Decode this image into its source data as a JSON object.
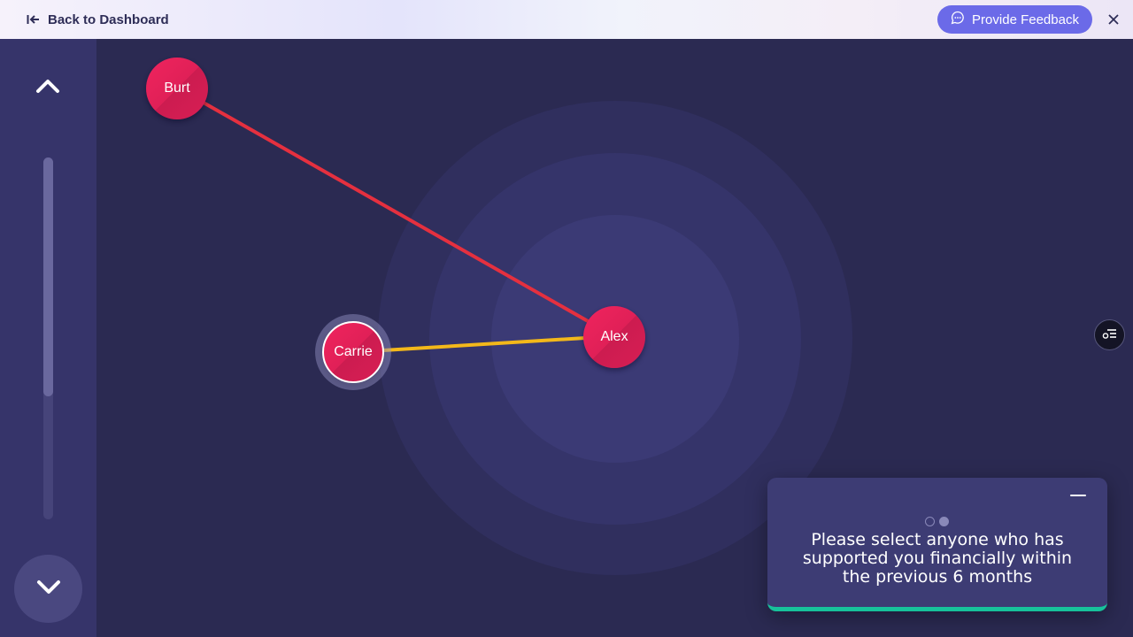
{
  "header": {
    "back_label": "Back to Dashboard",
    "feedback_label": "Provide Feedback"
  },
  "sidebar": {
    "scroll_position": 0.0,
    "scroll_visible_fraction": 0.66
  },
  "network": {
    "nodes": [
      {
        "id": "burt",
        "label": "Burt",
        "selected": false
      },
      {
        "id": "carrie",
        "label": "Carrie",
        "selected": true
      },
      {
        "id": "alex",
        "label": "Alex",
        "selected": false
      }
    ],
    "edges": [
      {
        "from": "Burt",
        "to": "Alex",
        "color": "#e5303f"
      },
      {
        "from": "Carrie",
        "to": "Alex",
        "color": "#f3b81a"
      }
    ]
  },
  "prompt": {
    "text": "Please select anyone who has supported you financially within the previous 6 months",
    "current_step": 2,
    "total_steps": 2,
    "accent_color": "#17c29b"
  },
  "colors": {
    "brand": "#6b6ae8",
    "node": "#e02057",
    "background": "#2b2a52"
  }
}
